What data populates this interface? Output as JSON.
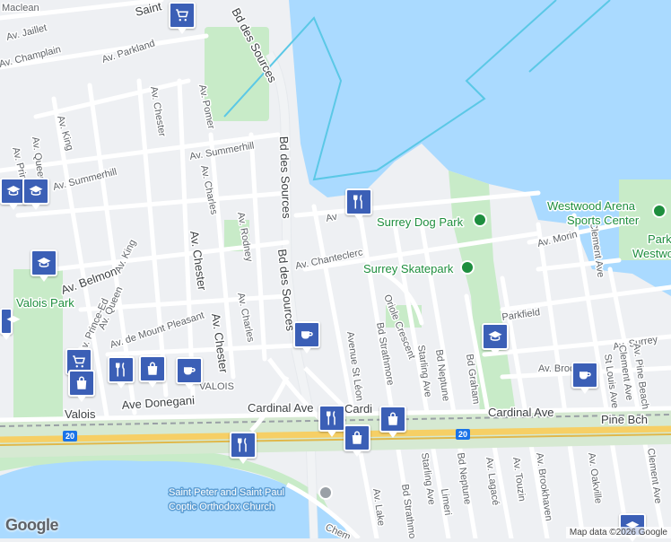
{
  "attribution": "Map data ©2026 Google",
  "logo": "Google",
  "highway_shield": "20",
  "streets": {
    "champlain": "Av. Champlain",
    "jaillet": "Av. Jaillet",
    "maclean": "Maclean",
    "parkland": "Av. Parkland",
    "king": "Av. King",
    "chester_top": "Av. Chester",
    "pomer": "Av. Pomer",
    "summerhill_e": "Av. Summerhill",
    "summerhill_w": "Av. Summerhill",
    "queen_n": "Av. Queen",
    "prince_n": "Av. Prince-E",
    "charles_n": "Av. Charles",
    "rodney": "Av. Rodney",
    "chester_mid": "Av. Chester",
    "chester_s": "Av. Chester",
    "des_sources_n": "Bd des Sources",
    "des_sources_mid": "Bd des Sources",
    "des_sources_top": "Bd des Sources",
    "belmont": "Av. Belmont",
    "king_s": "Av. King",
    "queen_s": "Av. Queen",
    "prince_s": "Av. Prince-Ed",
    "mount_pleasant": "Av. de Mount Pleasant",
    "charles_s": "Av. Charles",
    "chanteclerc": "Av. Chanteclerc",
    "av_top": "Av",
    "st_leon": "Avenue St Léon",
    "strathmore": "Bd Strathmore",
    "oriole": "Oriole Crescent",
    "starling": "Starling Ave",
    "neptune": "Bd Neptune",
    "graham": "Bd Graham",
    "parkfield": "Parkfield",
    "morin": "Av. Morin",
    "clement": "Clement Ave",
    "st_louis": "St Louis Ave",
    "surrey": "Av. Surrey",
    "brookdale": "Av. Brook",
    "pine_beach": "Av. Pine Beach",
    "clement_s": "Clement Ave",
    "oakville": "Av. Oakville",
    "brookhaven": "Av. Brookhaven",
    "touzin": "Av. Touzin",
    "lagace": "Av. Lagacé",
    "neptune_s": "Bd Neptune",
    "starling_s": "Starling Ave",
    "strathmore_s": "Bd Strathmo",
    "lake": "Av. Lake",
    "limerick": "Limeri",
    "ave_donegani": "Ave Donegani",
    "cardinal_w": "Cardinal Ave",
    "cardinal_e": "Cardinal Ave",
    "cardi": "Cardi",
    "chem": "Chem",
    "valois_station": "Valois",
    "valois_label": "VALOIS",
    "pine_bch": "Pine Bch",
    "saint": "Saint"
  },
  "pois": {
    "surrey_dog_park": "Surrey Dog Park",
    "surrey_skatepark": "Surrey Skatepark",
    "westwood_arena": "Westwood Arena",
    "sports_center": "Sports Center",
    "westwood_park": "Westwood",
    "westwood_park2": "Park",
    "valois_park": "Valois Park",
    "church1": "Saint Peter and Saint Paul",
    "church2": "Coptic Orthodox Church"
  },
  "colors": {
    "water": "#aadaff",
    "park": "#c8ebc8",
    "road": "#ffffff",
    "highway": "#f6cf65",
    "land": "#eef0f3",
    "pin": "#3b5fb6",
    "poi_green": "#1e8e3e"
  }
}
